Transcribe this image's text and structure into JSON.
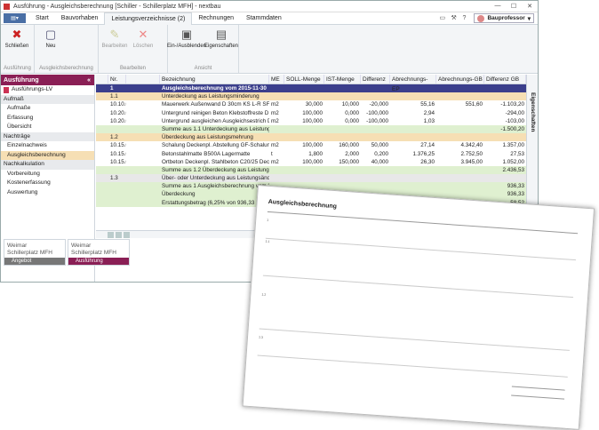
{
  "window": {
    "title": "Ausführung - Ausgleichsberechnung [Schiller - Schillerplatz MFH] - nextbau"
  },
  "menu": {
    "tabs": [
      "Start",
      "Bauvorhaben",
      "Leistungsverzeichnisse (2)",
      "Rechnungen",
      "Stammdaten"
    ],
    "active": 2,
    "user": "Bauprofessor"
  },
  "ribbon": {
    "groups": [
      {
        "label": "Ausführung",
        "buttons": [
          {
            "label": "Schließen",
            "icon": "close-doc-icon"
          }
        ]
      },
      {
        "label": "Ausgleichsberechnung",
        "buttons": [
          {
            "label": "Neu",
            "icon": "new-doc-icon"
          }
        ]
      },
      {
        "label": "Bearbeiten",
        "buttons": [
          {
            "label": "Bearbeiten",
            "icon": "edit-icon"
          },
          {
            "label": "Löschen",
            "icon": "delete-icon"
          }
        ]
      },
      {
        "label": "Ansicht",
        "buttons": [
          {
            "label": "Ein-/Ausblenden",
            "icon": "toolbox-icon"
          },
          {
            "label": "Eigenschaften",
            "icon": "properties-icon"
          }
        ]
      }
    ]
  },
  "left": {
    "header": "Ausführung",
    "top_item": "Ausführungs-LV",
    "sections": [
      {
        "title": "Aufmaß",
        "items": [
          "Aufmaße",
          "Erfassung",
          "Übersicht"
        ]
      },
      {
        "title": "Nachträge",
        "items": [
          "Einzelnachweis",
          "Ausgleichsberechnung"
        ]
      },
      {
        "title": "Nachkalkulation",
        "items": [
          "Vorbereitung",
          "Kostenerfassung",
          "Auswertung"
        ]
      }
    ],
    "selected": "Ausgleichsberechnung"
  },
  "doc_tabs": [
    {
      "line1": "Weimar",
      "line2": "Schillerplatz MFH",
      "stripe": "Angebot",
      "active": false
    },
    {
      "line1": "Weimar",
      "line2": "Schillerplatz MFH",
      "stripe": "Ausführung",
      "active": true
    }
  ],
  "grid": {
    "columns": [
      "",
      "Nr.",
      "",
      "Bezeichnung",
      "ME",
      "SOLL-Menge",
      "IST-Menge",
      "Differenz",
      "Abrechnungs-EP",
      "Abrechnungs-GB",
      "Differenz GB"
    ],
    "rows": [
      {
        "type": "sel",
        "cells": [
          "",
          "1",
          "",
          "Ausgleichsberechnung vom 2015-11-30",
          "",
          "",
          "",
          "",
          "",
          "",
          ""
        ]
      },
      {
        "type": "grp",
        "cells": [
          "",
          "1.1",
          "",
          "Unterdeckung aus Leistungsminderung",
          "",
          "",
          "",
          "",
          "",
          "",
          ""
        ]
      },
      {
        "type": "",
        "cells": [
          "",
          "10.10.0010",
          "",
          "Mauerwerk Außenwand D 30cm KS L-R SFK12",
          "m2",
          "30,000",
          "10,000",
          "-20,000",
          "55,16",
          "551,60",
          "-1.103,20"
        ]
      },
      {
        "type": "",
        "cells": [
          "",
          "10.20.0010",
          "",
          "Untergrund reinigen Beton Klebstoffreste D bis",
          "m2",
          "100,000",
          "0,000",
          "-100,000",
          "2,94",
          "",
          "-294,00"
        ]
      },
      {
        "type": "",
        "cells": [
          "",
          "10.20.0020",
          "",
          "Untergrund ausgleichen Ausgleichsestrich D bis",
          "m2",
          "100,000",
          "0,000",
          "-100,000",
          "1,03",
          "",
          "-103,00"
        ]
      },
      {
        "type": "sum",
        "cells": [
          "",
          "",
          "",
          "Summe aus 1.1 Unterdeckung aus Leistungsm",
          "",
          "",
          "",
          "",
          "",
          "",
          "-1.500,20"
        ]
      },
      {
        "type": "grp",
        "cells": [
          "",
          "1.2",
          "",
          "Überdeckung aus Leistungsmehrung",
          "",
          "",
          "",
          "",
          "",
          "",
          ""
        ]
      },
      {
        "type": "",
        "cells": [
          "",
          "10.15.0015",
          "",
          "Schalung Deckenpl. Abstellung GF-Schalungsp",
          "m2",
          "100,000",
          "160,000",
          "50,000",
          "27,14",
          "4.342,40",
          "1.357,00"
        ]
      },
      {
        "type": "",
        "cells": [
          "",
          "10.15.0025",
          "",
          "Betonstahlmatte B500A Lagermatte",
          "t",
          "1,800",
          "2,000",
          "0,200",
          "1.376,25",
          "2.752,50",
          "27,53"
        ]
      },
      {
        "type": "",
        "cells": [
          "",
          "10.15.0040",
          "",
          "Ortbeton Deckenpl. Stahlbeton C20/25 Decken",
          "m2",
          "100,000",
          "150,000",
          "40,000",
          "26,30",
          "3.945,00",
          "1.052,00"
        ]
      },
      {
        "type": "sum",
        "cells": [
          "",
          "",
          "",
          "Summe aus 1.2 Überdeckung aus Leistungsme",
          "",
          "",
          "",
          "",
          "",
          "",
          "2.436,53"
        ]
      },
      {
        "type": "unter",
        "cells": [
          "",
          "1.3",
          "",
          "Über- oder Unterdeckung aus Leistungsände",
          "",
          "",
          "",
          "",
          "",
          "",
          ""
        ]
      },
      {
        "type": "sum",
        "cells": [
          "",
          "",
          "",
          "Summe aus 1 Ausgleichsberechnung vom 2",
          "",
          "",
          "",
          "",
          "",
          "",
          "936,33"
        ]
      },
      {
        "type": "sum",
        "cells": [
          "",
          "",
          "",
          "Überdeckung",
          "",
          "",
          "",
          "",
          "",
          "",
          "936,33"
        ]
      },
      {
        "type": "sum",
        "cells": [
          "",
          "",
          "",
          "Erstattungsbetrag (6,25% von 936,33 EUR",
          "",
          "",
          "",
          "",
          "",
          "",
          "58,52"
        ]
      }
    ]
  },
  "right_panel": {
    "label": "Eigenschaften"
  },
  "report": {
    "header": "Ausgleichsberechnung",
    "lines": [
      "1",
      "1.1",
      "1.2",
      "1.3"
    ]
  }
}
